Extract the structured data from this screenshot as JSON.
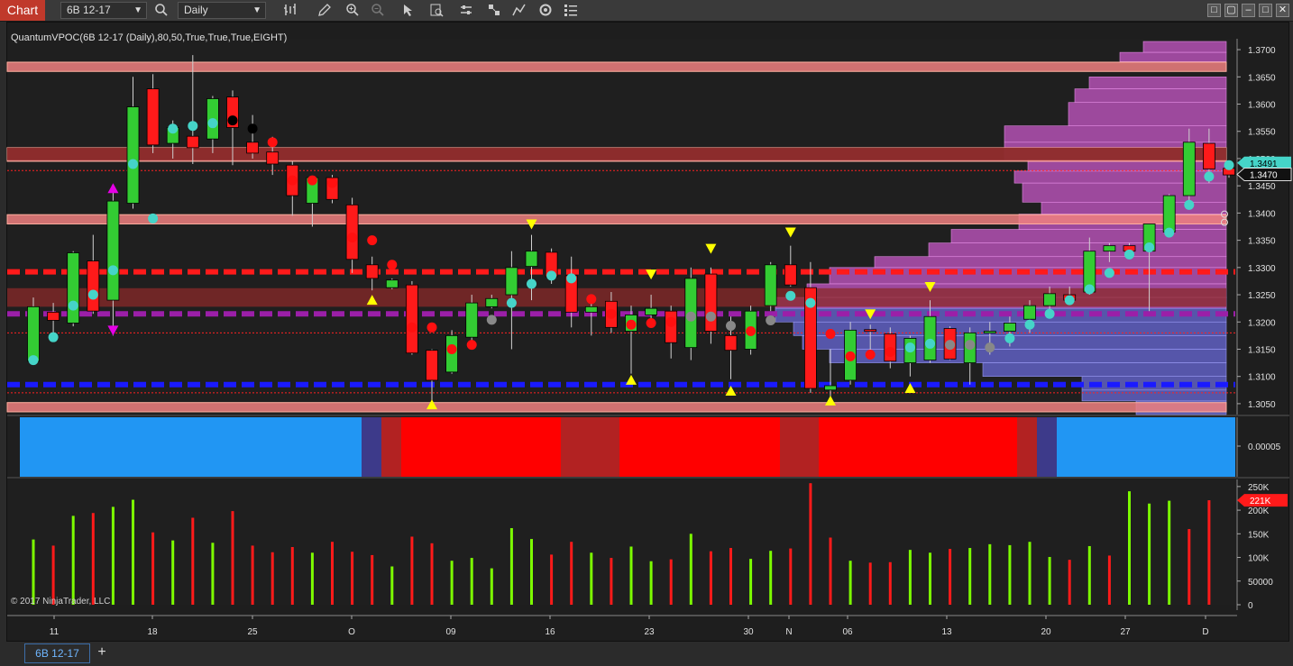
{
  "app": {
    "chart_tab_label": "Chart",
    "instrument": "6B 12-17",
    "timeframe": "Daily",
    "indicator_title": "QuantumVPOC(6B 12-17 (Daily),80,50,True,True,True,EIGHT)",
    "copyright": "© 2017 NinjaTrader, LLC",
    "bottom_tab": "6B 12-17",
    "add_tab": "+"
  },
  "toolbar_icons": [
    "bar-type-icon",
    "pencil-icon",
    "zoom-in-icon",
    "zoom-out-icon",
    "pointer-icon",
    "data-box-icon",
    "properties-icon",
    "strategies-icon",
    "drawing-tools-icon",
    "refresh-icon",
    "templates-icon"
  ],
  "colors": {
    "up": "#33cc33",
    "down": "#ff1a1a",
    "accent": "#c0392b",
    "cyan": "#45d4c8",
    "vpoc_red": "#ff1a1a",
    "vpoc_blue": "#1a1aff",
    "vpoc_purple": "#9b1fa8"
  },
  "price_axis": {
    "labels": [
      "1.3700",
      "1.3650",
      "1.3600",
      "1.3550",
      "1.3500",
      "1.3450",
      "1.3400",
      "1.3350",
      "1.3300",
      "1.3250",
      "1.3200",
      "1.3150",
      "1.3100",
      "1.3050"
    ],
    "last_price_cyan": "1.3491",
    "last_price_dark": "1.3470"
  },
  "indicator_axis": {
    "labels": [
      "0.00005"
    ]
  },
  "volume_axis": {
    "labels": [
      "250K",
      "200K",
      "150K",
      "100K",
      "50000",
      "0"
    ],
    "current": "221K"
  },
  "time_axis": {
    "labels": [
      "11",
      "18",
      "25",
      "O",
      "09",
      "16",
      "23",
      "30",
      "N",
      "06",
      "13",
      "20",
      "27",
      "D"
    ]
  },
  "chart_data": {
    "type": "candlestick",
    "ylim": [
      1.303,
      1.372
    ],
    "candles": [
      {
        "o": 1.3128,
        "h": 1.3245,
        "l": 1.3125,
        "c": 1.3228,
        "m": "cy",
        "mp": 1.313
      },
      {
        "o": 1.3218,
        "h": 1.3235,
        "l": 1.3178,
        "c": 1.3203,
        "m": "cy",
        "mp": 1.3172
      },
      {
        "o": 1.3198,
        "h": 1.333,
        "l": 1.3192,
        "c": 1.3327,
        "m": "cy",
        "mp": 1.323
      },
      {
        "o": 1.3312,
        "h": 1.336,
        "l": 1.3215,
        "c": 1.322,
        "m": "cy",
        "mp": 1.325
      },
      {
        "o": 1.324,
        "h": 1.344,
        "l": 1.3175,
        "c": 1.3422,
        "m": "cy",
        "mp": 1.3295,
        "a": "mu",
        "ap": 1.3445,
        "b": "md",
        "bp": 1.3185
      },
      {
        "o": 1.3418,
        "h": 1.365,
        "l": 1.3408,
        "c": 1.3595,
        "m": "cy",
        "mp": 1.349
      },
      {
        "o": 1.3628,
        "h": 1.3655,
        "l": 1.351,
        "c": 1.3525,
        "m": "cy",
        "mp": 1.339
      },
      {
        "o": 1.3528,
        "h": 1.357,
        "l": 1.35,
        "c": 1.3557,
        "m": "cy",
        "mp": 1.3555
      },
      {
        "o": 1.3541,
        "h": 1.369,
        "l": 1.349,
        "c": 1.352,
        "m": "cy",
        "mp": 1.356
      },
      {
        "o": 1.3536,
        "h": 1.3615,
        "l": 1.351,
        "c": 1.361,
        "m": "cy",
        "mp": 1.3565
      },
      {
        "o": 1.3613,
        "h": 1.3625,
        "l": 1.3488,
        "c": 1.3557,
        "m": "gr",
        "mp": 1.357
      },
      {
        "o": 1.353,
        "h": 1.358,
        "l": 1.35,
        "c": 1.351,
        "m": "gr",
        "mp": 1.3555
      },
      {
        "o": 1.3512,
        "h": 1.354,
        "l": 1.347,
        "c": 1.349,
        "m": "rd",
        "mp": 1.353
      },
      {
        "o": 1.3488,
        "h": 1.3495,
        "l": 1.3395,
        "c": 1.3432,
        "m": "rd",
        "mp": 1.346
      },
      {
        "o": 1.3418,
        "h": 1.3468,
        "l": 1.3375,
        "c": 1.3465,
        "m": "rd",
        "mp": 1.346
      },
      {
        "o": 1.3465,
        "h": 1.347,
        "l": 1.3418,
        "c": 1.3425,
        "m": "rd",
        "mp": 1.3455
      },
      {
        "o": 1.3415,
        "h": 1.3428,
        "l": 1.329,
        "c": 1.3315,
        "m": "rd",
        "mp": 1.3355
      },
      {
        "o": 1.3305,
        "h": 1.332,
        "l": 1.3258,
        "c": 1.328,
        "m": "rd",
        "mp": 1.335,
        "b": "yu",
        "bp": 1.324
      },
      {
        "o": 1.3263,
        "h": 1.328,
        "l": 1.326,
        "c": 1.3277,
        "m": "rd",
        "mp": 1.3305
      },
      {
        "o": 1.3268,
        "h": 1.3275,
        "l": 1.314,
        "c": 1.3143,
        "m": "rd",
        "mp": 1.319
      },
      {
        "o": 1.3148,
        "h": 1.315,
        "l": 1.305,
        "c": 1.3093,
        "m": "rd",
        "mp": 1.319,
        "b": "yu",
        "bp": 1.3048
      },
      {
        "o": 1.3108,
        "h": 1.3185,
        "l": 1.3105,
        "c": 1.3175,
        "m": "rd",
        "mp": 1.315
      },
      {
        "o": 1.3172,
        "h": 1.325,
        "l": 1.3165,
        "c": 1.3235,
        "m": "rd",
        "mp": 1.3158
      },
      {
        "o": 1.3228,
        "h": 1.325,
        "l": 1.3225,
        "c": 1.3243,
        "m": "gy",
        "mp": 1.3204
      },
      {
        "o": 1.325,
        "h": 1.333,
        "l": 1.315,
        "c": 1.33,
        "m": "cy",
        "mp": 1.3235
      },
      {
        "o": 1.3302,
        "h": 1.336,
        "l": 1.324,
        "c": 1.333,
        "m": "cy",
        "mp": 1.327,
        "a": "yd",
        "ap": 1.338
      },
      {
        "o": 1.3328,
        "h": 1.3335,
        "l": 1.327,
        "c": 1.3283,
        "m": "cy",
        "mp": 1.3285
      },
      {
        "o": 1.3285,
        "h": 1.332,
        "l": 1.319,
        "c": 1.3218,
        "m": "cy",
        "mp": 1.328
      },
      {
        "o": 1.3218,
        "h": 1.3245,
        "l": 1.3175,
        "c": 1.3228,
        "m": "rd",
        "mp": 1.3242
      },
      {
        "o": 1.3238,
        "h": 1.3255,
        "l": 1.318,
        "c": 1.319,
        "m": "rd",
        "mp": 1.3215
      },
      {
        "o": 1.3183,
        "h": 1.323,
        "l": 1.3105,
        "c": 1.3213,
        "m": "rd",
        "mp": 1.3195,
        "b": "yu",
        "bp": 1.3093
      },
      {
        "o": 1.3213,
        "h": 1.325,
        "l": 1.3195,
        "c": 1.3225,
        "m": "rd",
        "mp": 1.3198,
        "a": "yd",
        "ap": 1.3288
      },
      {
        "o": 1.322,
        "h": 1.323,
        "l": 1.3133,
        "c": 1.3162,
        "m": "rd",
        "mp": 1.32
      },
      {
        "o": 1.3153,
        "h": 1.33,
        "l": 1.313,
        "c": 1.328,
        "m": "gy",
        "mp": 1.321
      },
      {
        "o": 1.3288,
        "h": 1.33,
        "l": 1.316,
        "c": 1.3183,
        "m": "gy",
        "mp": 1.321,
        "a": "yd",
        "ap": 1.3335
      },
      {
        "o": 1.3175,
        "h": 1.321,
        "l": 1.3095,
        "c": 1.3148,
        "m": "gy",
        "mp": 1.3193,
        "b": "yu",
        "bp": 1.3073
      },
      {
        "o": 1.315,
        "h": 1.323,
        "l": 1.314,
        "c": 1.322,
        "m": "rd",
        "mp": 1.3183
      },
      {
        "o": 1.323,
        "h": 1.331,
        "l": 1.322,
        "c": 1.3305,
        "m": "gy",
        "mp": 1.3203
      },
      {
        "o": 1.3305,
        "h": 1.334,
        "l": 1.3265,
        "c": 1.3268,
        "m": "cy",
        "mp": 1.3248,
        "a": "yd",
        "ap": 1.3365
      },
      {
        "o": 1.3263,
        "h": 1.331,
        "l": 1.307,
        "c": 1.3078,
        "m": "cy",
        "mp": 1.3235
      },
      {
        "o": 1.3075,
        "h": 1.315,
        "l": 1.3058,
        "c": 1.3083,
        "m": "rd",
        "mp": 1.3178,
        "b": "yu",
        "bp": 1.3055
      },
      {
        "o": 1.3093,
        "h": 1.32,
        "l": 1.3085,
        "c": 1.3185,
        "m": "rd",
        "mp": 1.3137
      },
      {
        "o": 1.3186,
        "h": 1.3195,
        "l": 1.3135,
        "c": 1.3183,
        "m": "rd",
        "mp": 1.314,
        "a": "yd",
        "ap": 1.3215
      },
      {
        "o": 1.3178,
        "h": 1.319,
        "l": 1.3115,
        "c": 1.3128,
        "m": "rd",
        "mp": 1.3145
      },
      {
        "o": 1.3125,
        "h": 1.3175,
        "l": 1.31,
        "c": 1.317,
        "m": "cy",
        "mp": 1.3153,
        "b": "yu",
        "bp": 1.3078
      },
      {
        "o": 1.313,
        "h": 1.324,
        "l": 1.3125,
        "c": 1.321,
        "m": "cy",
        "mp": 1.316,
        "a": "yd",
        "ap": 1.3265
      },
      {
        "o": 1.3188,
        "h": 1.3192,
        "l": 1.313,
        "c": 1.3132,
        "m": "gy",
        "mp": 1.3158
      },
      {
        "o": 1.3125,
        "h": 1.319,
        "l": 1.3085,
        "c": 1.318,
        "m": "gy",
        "mp": 1.3158
      },
      {
        "o": 1.318,
        "h": 1.32,
        "l": 1.314,
        "c": 1.3183,
        "m": "gy",
        "mp": 1.3153
      },
      {
        "o": 1.3183,
        "h": 1.321,
        "l": 1.3155,
        "c": 1.3198,
        "m": "cy",
        "mp": 1.317
      },
      {
        "o": 1.3205,
        "h": 1.324,
        "l": 1.318,
        "c": 1.323,
        "m": "cy",
        "mp": 1.3195
      },
      {
        "o": 1.323,
        "h": 1.3265,
        "l": 1.3215,
        "c": 1.3252,
        "m": "cy",
        "mp": 1.3215
      },
      {
        "o": 1.325,
        "h": 1.3265,
        "l": 1.3233,
        "c": 1.324,
        "m": "cy",
        "mp": 1.324
      },
      {
        "o": 1.3255,
        "h": 1.3355,
        "l": 1.325,
        "c": 1.333,
        "m": "cy",
        "mp": 1.326
      },
      {
        "o": 1.333,
        "h": 1.3345,
        "l": 1.331,
        "c": 1.334,
        "m": "cy",
        "mp": 1.329
      },
      {
        "o": 1.334,
        "h": 1.3345,
        "l": 1.332,
        "c": 1.333,
        "m": "cy",
        "mp": 1.3324
      },
      {
        "o": 1.333,
        "h": 1.338,
        "l": 1.322,
        "c": 1.338,
        "m": "cy",
        "mp": 1.3337
      },
      {
        "o": 1.3365,
        "h": 1.3435,
        "l": 1.336,
        "c": 1.3432,
        "m": "cy",
        "mp": 1.3364
      },
      {
        "o": 1.3432,
        "h": 1.3555,
        "l": 1.341,
        "c": 1.353,
        "m": "cy",
        "mp": 1.3415
      },
      {
        "o": 1.3528,
        "h": 1.3555,
        "l": 1.3455,
        "c": 1.3481,
        "m": "cy",
        "mp": 1.3467
      },
      {
        "o": 1.3482,
        "h": 1.3492,
        "l": 1.3465,
        "c": 1.347,
        "m": "cy",
        "mp": 1.3488
      }
    ],
    "volume": [
      {
        "v": 138000,
        "up": true
      },
      {
        "v": 125000,
        "up": false
      },
      {
        "v": 188000,
        "up": true
      },
      {
        "v": 194000,
        "up": false
      },
      {
        "v": 207000,
        "up": true
      },
      {
        "v": 222000,
        "up": true
      },
      {
        "v": 153000,
        "up": false
      },
      {
        "v": 136000,
        "up": true
      },
      {
        "v": 184000,
        "up": false
      },
      {
        "v": 131000,
        "up": true
      },
      {
        "v": 198000,
        "up": false
      },
      {
        "v": 125000,
        "up": false
      },
      {
        "v": 111000,
        "up": false
      },
      {
        "v": 122000,
        "up": false
      },
      {
        "v": 110000,
        "up": true
      },
      {
        "v": 133000,
        "up": false
      },
      {
        "v": 112000,
        "up": false
      },
      {
        "v": 105000,
        "up": false
      },
      {
        "v": 81000,
        "up": true
      },
      {
        "v": 144000,
        "up": false
      },
      {
        "v": 130000,
        "up": false
      },
      {
        "v": 93000,
        "up": true
      },
      {
        "v": 99000,
        "up": true
      },
      {
        "v": 77000,
        "up": true
      },
      {
        "v": 162000,
        "up": true
      },
      {
        "v": 139000,
        "up": true
      },
      {
        "v": 106000,
        "up": false
      },
      {
        "v": 133000,
        "up": false
      },
      {
        "v": 110000,
        "up": true
      },
      {
        "v": 99000,
        "up": false
      },
      {
        "v": 123000,
        "up": true
      },
      {
        "v": 92000,
        "up": true
      },
      {
        "v": 96000,
        "up": false
      },
      {
        "v": 150000,
        "up": true
      },
      {
        "v": 113000,
        "up": false
      },
      {
        "v": 120000,
        "up": false
      },
      {
        "v": 97000,
        "up": true
      },
      {
        "v": 114000,
        "up": true
      },
      {
        "v": 119000,
        "up": false
      },
      {
        "v": 257000,
        "up": false
      },
      {
        "v": 142000,
        "up": false
      },
      {
        "v": 93000,
        "up": true
      },
      {
        "v": 89000,
        "up": false
      },
      {
        "v": 90000,
        "up": false
      },
      {
        "v": 116000,
        "up": true
      },
      {
        "v": 110000,
        "up": true
      },
      {
        "v": 118000,
        "up": false
      },
      {
        "v": 120000,
        "up": true
      },
      {
        "v": 128000,
        "up": true
      },
      {
        "v": 126000,
        "up": true
      },
      {
        "v": 133000,
        "up": true
      },
      {
        "v": 101000,
        "up": true
      },
      {
        "v": 95000,
        "up": false
      },
      {
        "v": 124000,
        "up": true
      },
      {
        "v": 104000,
        "up": false
      },
      {
        "v": 240000,
        "up": true
      },
      {
        "v": 214000,
        "up": true
      },
      {
        "v": 220000,
        "up": true
      },
      {
        "v": 160000,
        "up": false
      },
      {
        "v": 221000,
        "up": false
      }
    ],
    "vpoc_lines": [
      {
        "price": 1.3292,
        "color": "#ff1a1a"
      },
      {
        "price": 1.3215,
        "color": "#9b1fa8"
      },
      {
        "price": 1.3085,
        "color": "#1a1aff"
      }
    ],
    "zones": [
      {
        "low": 1.366,
        "high": 1.3677
      },
      {
        "low": 1.3495,
        "high": 1.352
      },
      {
        "low": 1.338,
        "high": 1.3397
      },
      {
        "low": 1.3035,
        "high": 1.3052
      }
    ],
    "indicator_bands": [
      "#2196f3",
      "#3d3a8a",
      "#b22222",
      "#ff0000",
      "#b22222",
      "#ff0000",
      "#b22222",
      "#ff0000",
      "#b22222",
      "#3d3a8a",
      "#2196f3"
    ]
  }
}
